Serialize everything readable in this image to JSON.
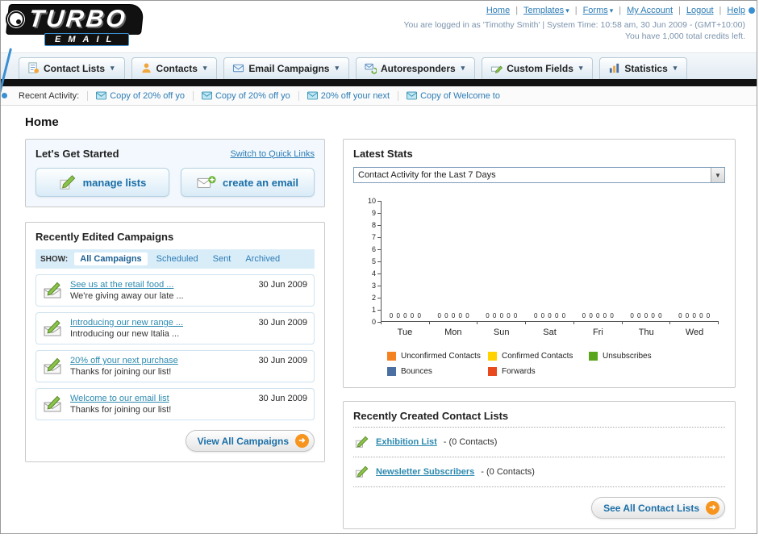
{
  "brand": {
    "name_top": "TURBO",
    "name_bottom": "EMAIL"
  },
  "header": {
    "links": [
      {
        "label": "Home",
        "dropdown": false
      },
      {
        "label": "Templates",
        "dropdown": true
      },
      {
        "label": "Forms",
        "dropdown": true
      },
      {
        "label": "My Account",
        "dropdown": false
      },
      {
        "label": "Logout",
        "dropdown": false
      },
      {
        "label": "Help",
        "dropdown": false
      }
    ],
    "login_info": "You are logged in as 'Timothy Smith' | System Time: 10:58 am, 30 Jun 2009 - (GMT+10:00)",
    "credits_info": "You have 1,000 total credits left."
  },
  "nav": {
    "tabs": [
      {
        "label": "Contact Lists",
        "icon": "contact-lists-icon"
      },
      {
        "label": "Contacts",
        "icon": "contacts-icon"
      },
      {
        "label": "Email Campaigns",
        "icon": "email-campaigns-icon"
      },
      {
        "label": "Autoresponders",
        "icon": "autoresponders-icon"
      },
      {
        "label": "Custom Fields",
        "icon": "custom-fields-icon"
      },
      {
        "label": "Statistics",
        "icon": "statistics-icon"
      }
    ]
  },
  "recent_activity": {
    "label": "Recent Activity:",
    "items": [
      "Copy of 20% off yo",
      "Copy of 20% off yo",
      "20% off your next",
      "Copy of Welcome to"
    ]
  },
  "page": {
    "title": "Home"
  },
  "get_started": {
    "title": "Let's Get Started",
    "switch_link": "Switch to Quick Links",
    "manage_lists_label": "manage lists",
    "create_email_label": "create an email"
  },
  "campaigns": {
    "title": "Recently Edited Campaigns",
    "show_label": "SHOW:",
    "filters": [
      "All Campaigns",
      "Scheduled",
      "Sent",
      "Archived"
    ],
    "active_filter": "All Campaigns",
    "items": [
      {
        "title": "See us at the retail food ...",
        "subtitle": "We're giving away our late ...",
        "date": "30 Jun 2009"
      },
      {
        "title": "Introducing our new range ...",
        "subtitle": "Introducing our new Italia ...",
        "date": "30 Jun 2009"
      },
      {
        "title": "20% off your next purchase",
        "subtitle": "Thanks for joining our list!",
        "date": "30 Jun 2009"
      },
      {
        "title": "Welcome to our email list",
        "subtitle": "Thanks for joining our list!",
        "date": "30 Jun 2009"
      }
    ],
    "view_all_label": "View All Campaigns"
  },
  "stats": {
    "title": "Latest Stats",
    "activity_select_value": "Contact Activity for the Last 7 Days"
  },
  "chart_data": {
    "type": "bar",
    "title": "Contact Activity for the Last 7 Days",
    "categories": [
      "Tue",
      "Mon",
      "Sun",
      "Sat",
      "Fri",
      "Thu",
      "Wed"
    ],
    "series": [
      {
        "name": "Unconfirmed Contacts",
        "color": "#f58220",
        "values": [
          0,
          0,
          0,
          0,
          0,
          0,
          0
        ]
      },
      {
        "name": "Confirmed Contacts",
        "color": "#ffd200",
        "values": [
          0,
          0,
          0,
          0,
          0,
          0,
          0
        ]
      },
      {
        "name": "Unsubscribes",
        "color": "#5aa51e",
        "values": [
          0,
          0,
          0,
          0,
          0,
          0,
          0
        ]
      },
      {
        "name": "Bounces",
        "color": "#4a6fa0",
        "values": [
          0,
          0,
          0,
          0,
          0,
          0,
          0
        ]
      },
      {
        "name": "Forwards",
        "color": "#e8491d",
        "values": [
          0,
          0,
          0,
          0,
          0,
          0,
          0
        ]
      }
    ],
    "ylim": [
      0,
      10
    ],
    "yticks": [
      0,
      1,
      2,
      3,
      4,
      5,
      6,
      7,
      8,
      9,
      10
    ],
    "grid": false,
    "legend_position": "bottom"
  },
  "contact_lists": {
    "title": "Recently Created Contact Lists",
    "items": [
      {
        "name": "Exhibition List",
        "detail": "- (0 Contacts)"
      },
      {
        "name": "Newsletter Subscribers",
        "detail": "- (0 Contacts)"
      }
    ],
    "see_all_label": "See All Contact Lists"
  },
  "colors": {
    "link_blue": "#2d7cb5",
    "campaign_link": "#2d8ab0",
    "accent_orange": "#f7941d",
    "nav_bar_black": "#121212",
    "panel_border": "#c9c9c9"
  }
}
